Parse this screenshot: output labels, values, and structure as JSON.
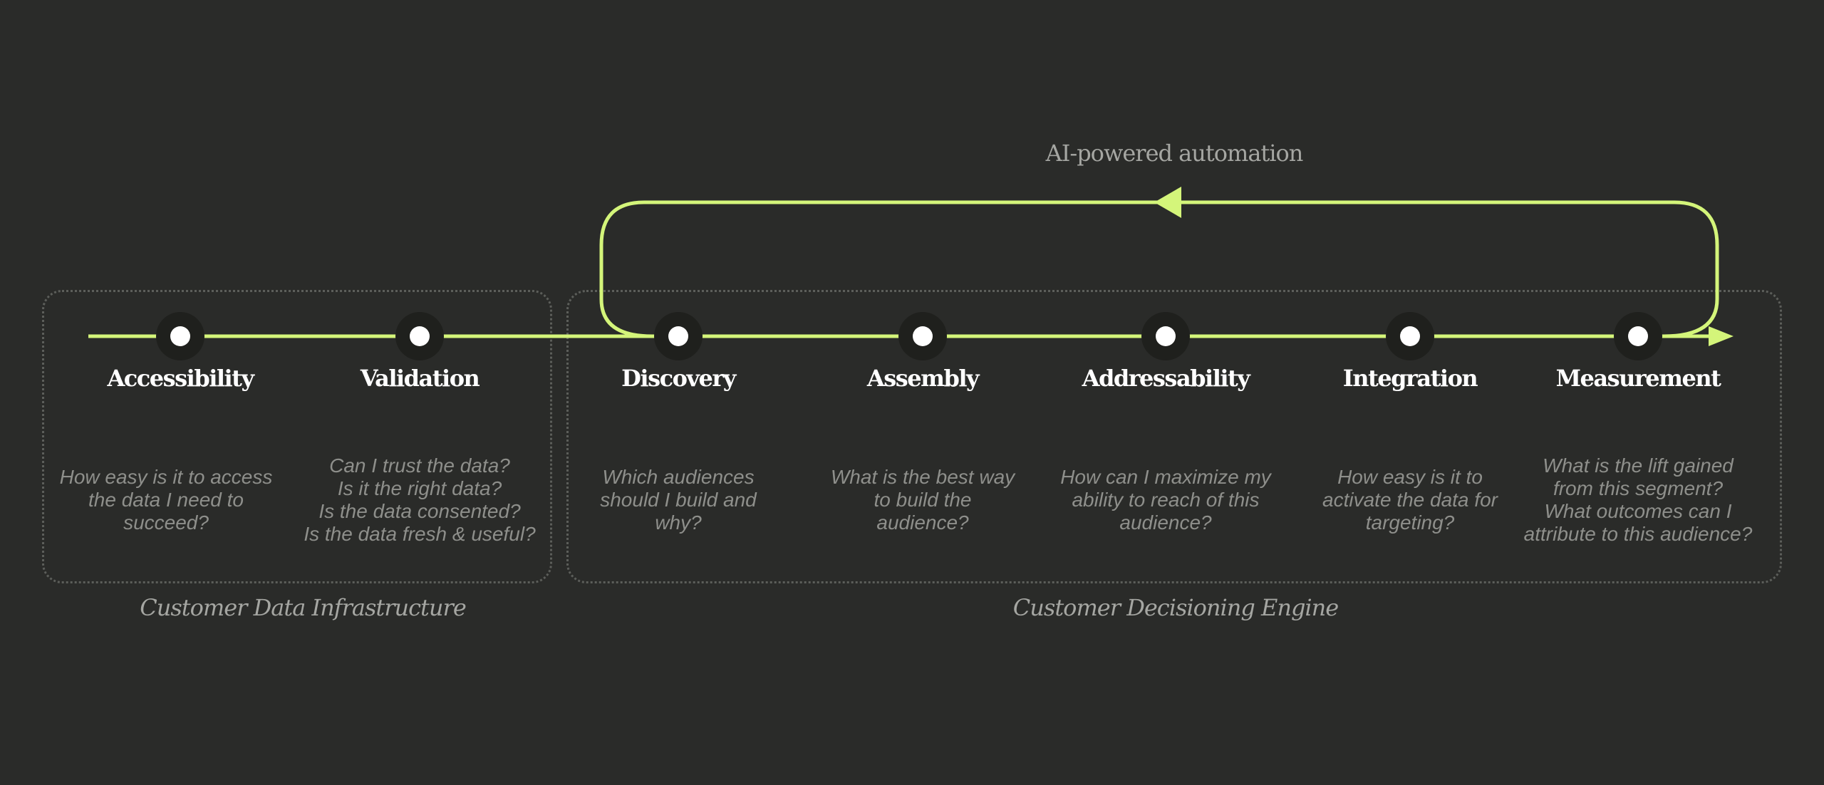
{
  "colors": {
    "background": "#2a2b29",
    "accent": "#d4f57a",
    "node_halo": "#1f201d",
    "node_dot": "#ffffff",
    "description_text": "#8e8f8b",
    "border": "#5c5e5a"
  },
  "loop_label": "AI-powered automation",
  "groups": [
    {
      "label": "Customer Data Infrastructure"
    },
    {
      "label": "Customer Decisioning Engine"
    }
  ],
  "stages": [
    {
      "title": "Accessibility",
      "description": "How easy is it to access\nthe data I need to\nsucceed?"
    },
    {
      "title": "Validation",
      "description": "Can I trust the data?\nIs it the right data?\nIs the data consented?\nIs the data fresh & useful?"
    },
    {
      "title": "Discovery",
      "description": "Which audiences\nshould I build and\nwhy?"
    },
    {
      "title": "Assembly",
      "description": "What is the best way\nto build the\naudience?"
    },
    {
      "title": "Addressability",
      "description": "How can I maximize my\nability to reach of this\naudience?"
    },
    {
      "title": "Integration",
      "description": "How easy is it to\nactivate the data for\ntargeting?"
    },
    {
      "title": "Measurement",
      "description": "What is the lift gained\nfrom this segment?\nWhat outcomes can I\nattribute to this audience?"
    }
  ]
}
